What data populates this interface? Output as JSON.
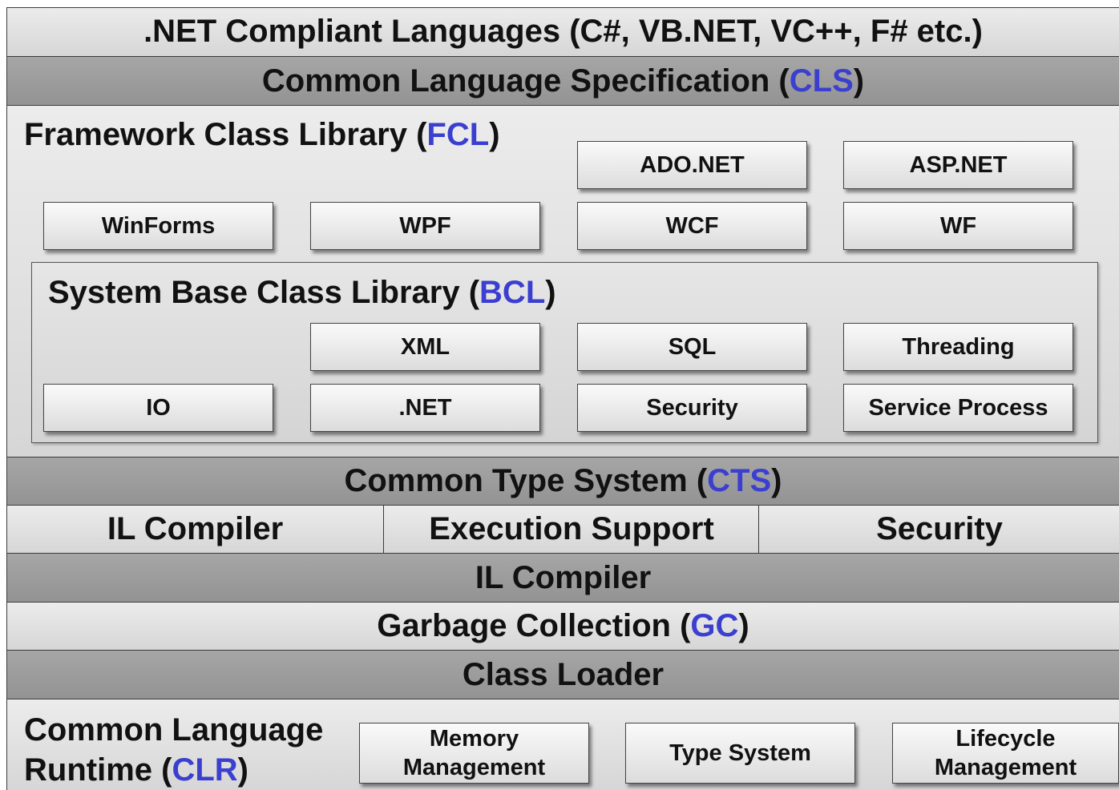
{
  "languages": ".NET Compliant Languages (C#, VB.NET, VC++, F# etc.)",
  "cls": {
    "label": "Common Language Specification (",
    "abbr": "CLS",
    "close": ")"
  },
  "fcl": {
    "label": "Framework Class Library (",
    "abbr": "FCL",
    "close": ")",
    "boxes": [
      "ADO.NET",
      "ASP.NET",
      "WinForms",
      "WPF",
      "WCF",
      "WF"
    ]
  },
  "bcl": {
    "label": "System Base Class Library (",
    "abbr": "BCL",
    "close": ")",
    "boxes": [
      "XML",
      "SQL",
      "Threading",
      "IO",
      ".NET",
      "Security",
      "Service Process"
    ]
  },
  "cts": {
    "label": "Common Type System (",
    "abbr": "CTS",
    "close": ")"
  },
  "exec_row": [
    "IL Compiler",
    "Execution Support",
    "Security"
  ],
  "il_compiler": "IL Compiler",
  "gc": {
    "label": "Garbage Collection (",
    "abbr": "GC",
    "close": ")"
  },
  "class_loader": "Class Loader",
  "clr": {
    "line1": "Common Language",
    "line2": "Runtime (",
    "abbr": "CLR",
    "close": ")",
    "boxes": [
      "Memory Management",
      "Type System",
      "Lifecycle Management"
    ]
  },
  "colors": {
    "accent": "#3b3fd0",
    "light_band": "#e0e0e0",
    "dark_band": "#9c9c9c"
  }
}
